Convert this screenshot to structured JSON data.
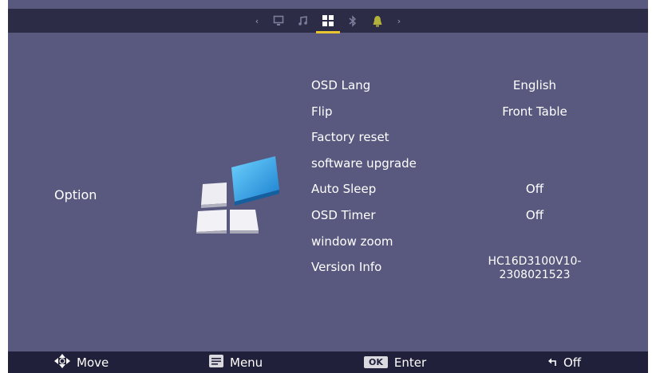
{
  "tabs": [
    {
      "icon": "monitor-icon"
    },
    {
      "icon": "music-icon"
    },
    {
      "icon": "option-grid-icon",
      "active": true
    },
    {
      "icon": "bluetooth-icon"
    },
    {
      "icon": "bell-icon"
    }
  ],
  "arrows": {
    "left": "‹",
    "right": "›"
  },
  "section": {
    "label": "Option",
    "icon": "option-grid-icon"
  },
  "menu": [
    {
      "label": "OSD Lang",
      "value": "English"
    },
    {
      "label": "Flip",
      "value": "Front Table"
    },
    {
      "label": "Factory reset",
      "value": ""
    },
    {
      "label": "software upgrade",
      "value": ""
    },
    {
      "label": "Auto Sleep",
      "value": "Off"
    },
    {
      "label": "OSD Timer",
      "value": "Off"
    },
    {
      "label": "window zoom",
      "value": ""
    },
    {
      "label": "Version Info",
      "value_line1": "HC16D3100V10-",
      "value_line2": "2308021523"
    }
  ],
  "footer": {
    "move": "Move",
    "menu": "Menu",
    "ok_key": "OK",
    "enter": "Enter",
    "off": "Off"
  },
  "colors": {
    "accent": "#e9c531",
    "background": "#59597f",
    "bar": "#2c2c46"
  }
}
